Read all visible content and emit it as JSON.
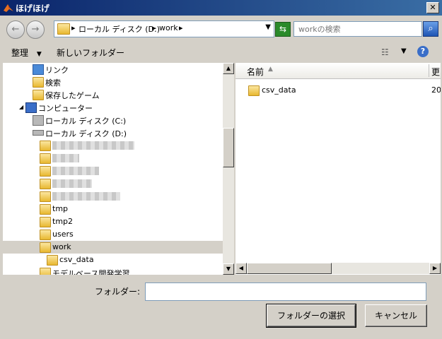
{
  "window": {
    "title": "ほげほげ"
  },
  "address": {
    "crumbs": [
      "ローカル ディスク (D:)",
      "work"
    ],
    "separator": "▸"
  },
  "search": {
    "placeholder": "workの検索"
  },
  "toolbar": {
    "organize": "整理",
    "new_folder": "新しいフォルダー"
  },
  "tree": {
    "items": [
      {
        "label": "リンク"
      },
      {
        "label": "検索"
      },
      {
        "label": "保存したゲーム"
      },
      {
        "label": "コンピューター"
      },
      {
        "label": "ローカル ディスク (C:)"
      },
      {
        "label": "ローカル ディスク (D:)"
      },
      {
        "label": "tmp"
      },
      {
        "label": "tmp2"
      },
      {
        "label": "users"
      },
      {
        "label": "work"
      },
      {
        "label": "csv_data"
      },
      {
        "label": "モデルベース開発学習"
      }
    ]
  },
  "files": {
    "column_name": "名前",
    "column_date": "更",
    "rows": [
      {
        "name": "csv_data",
        "date": "20"
      }
    ]
  },
  "bottom": {
    "folder_label": "フォルダー:",
    "folder_value": "",
    "select_button": "フォルダーの選択",
    "cancel_button": "キャンセル"
  }
}
